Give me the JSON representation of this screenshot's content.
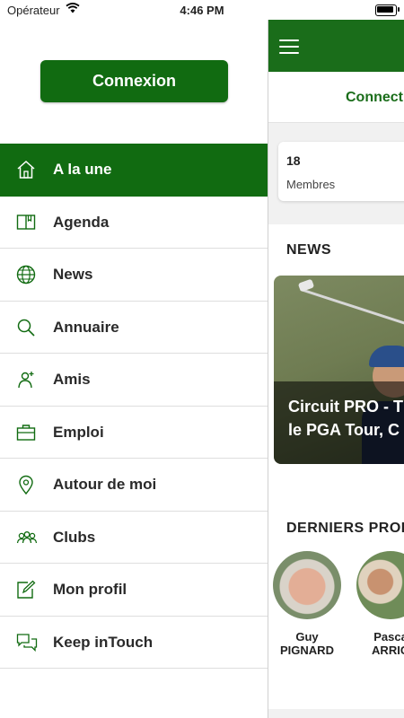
{
  "status_bar": {
    "carrier": "Opérateur",
    "time": "4:46 PM"
  },
  "drawer": {
    "login_button": "Connexion",
    "menu": [
      {
        "label": "A la une",
        "icon": "home-icon",
        "active": true
      },
      {
        "label": "Agenda",
        "icon": "book-icon"
      },
      {
        "label": "News",
        "icon": "globe-icon"
      },
      {
        "label": "Annuaire",
        "icon": "search-icon"
      },
      {
        "label": "Amis",
        "icon": "person-add-icon"
      },
      {
        "label": "Emploi",
        "icon": "briefcase-icon"
      },
      {
        "label": "Autour de moi",
        "icon": "location-pin-icon"
      },
      {
        "label": "Clubs",
        "icon": "group-icon"
      },
      {
        "label": "Mon profil",
        "icon": "edit-icon"
      },
      {
        "label": "Keep inTouch",
        "icon": "chat-icon"
      }
    ]
  },
  "main": {
    "connect_text": "Connect",
    "stat": {
      "value": "18",
      "label": "Membres"
    },
    "news_heading": "NEWS",
    "news_card": {
      "line1": "Circuit PRO - T",
      "line2": "le PGA Tour, C"
    },
    "profiles_heading": "DERNIERS PROF",
    "profiles": [
      {
        "first": "Guy",
        "last": "PIGNARD"
      },
      {
        "first": "Pasca",
        "last": "ARRIG"
      }
    ]
  },
  "colors": {
    "brand_green": "#116b11"
  }
}
